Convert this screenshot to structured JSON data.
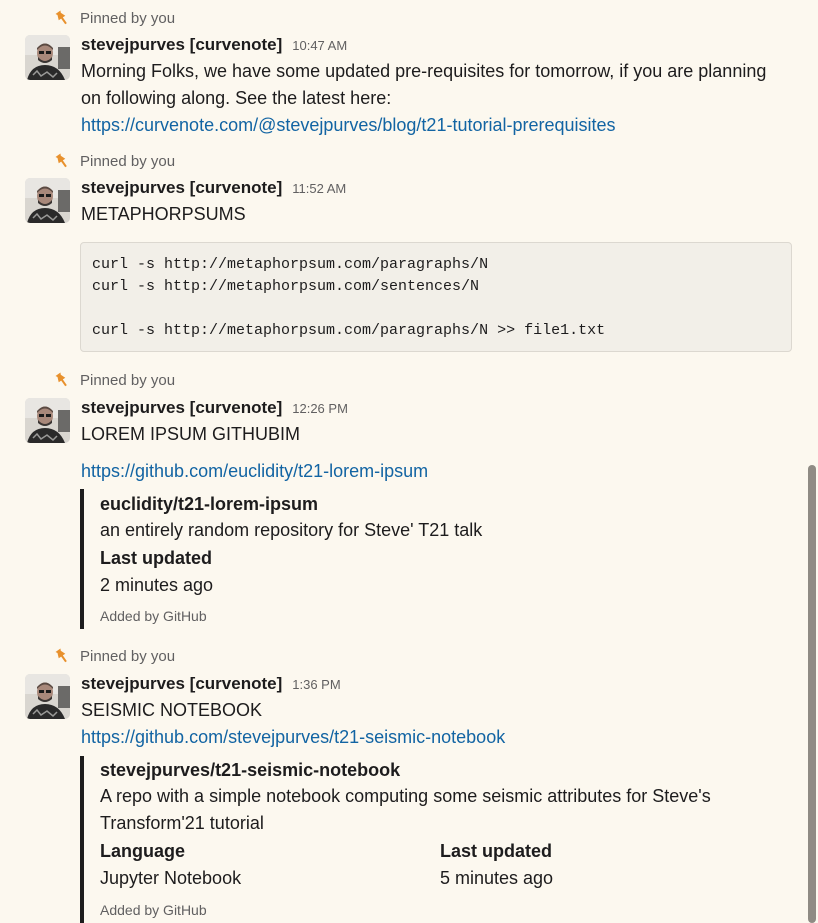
{
  "pinned_label": "Pinned by you",
  "colors": {
    "background": "#fcf8ef",
    "link": "#1264a3",
    "pin": "#e8912d",
    "muted": "#616061",
    "code_bg": "#f2efe8",
    "attachment_bar": "#1d1c1d"
  },
  "messages": [
    {
      "author": "stevejpurves [curvenote]",
      "time": "10:47 AM",
      "text_line1": "Morning Folks, we have some updated pre-requisites for tomorrow, if you are planning",
      "text_line2": "on following along. See the latest here:",
      "link": "https://curvenote.com/@stevejpurves/blog/t21-tutorial-prerequisites"
    },
    {
      "author": "stevejpurves [curvenote]",
      "time": "11:52 AM",
      "text": "METAPHORPSUMS",
      "code_lines": [
        "curl -s http://metaphorpsum.com/paragraphs/N",
        "curl -s http://metaphorpsum.com/sentences/N",
        "",
        "curl -s http://metaphorpsum.com/paragraphs/N >> file1.txt"
      ]
    },
    {
      "author": "stevejpurves [curvenote]",
      "time": "12:26 PM",
      "text": "LOREM IPSUM GITHUBIM",
      "link": "https://github.com/euclidity/t21-lorem-ipsum",
      "attachment": {
        "title": "euclidity/t21-lorem-ipsum",
        "description": "an entirely random repository for Steve' T21 talk",
        "field_label": "Last updated",
        "field_value": "2 minutes ago",
        "footer": "Added by GitHub"
      }
    },
    {
      "author": "stevejpurves [curvenote]",
      "time": "1:36 PM",
      "text": "SEISMIC NOTEBOOK",
      "link": "https://github.com/stevejpurves/t21-seismic-notebook",
      "attachment": {
        "title": "stevejpurves/t21-seismic-notebook",
        "description_line1": "A repo with a simple notebook computing some seismic attributes for Steve's",
        "description_line2": "Transform'21 tutorial",
        "fields": [
          {
            "label": "Language",
            "value": "Jupyter Notebook"
          },
          {
            "label": "Last updated",
            "value": "5 minutes ago"
          }
        ],
        "footer": "Added by GitHub"
      }
    }
  ]
}
